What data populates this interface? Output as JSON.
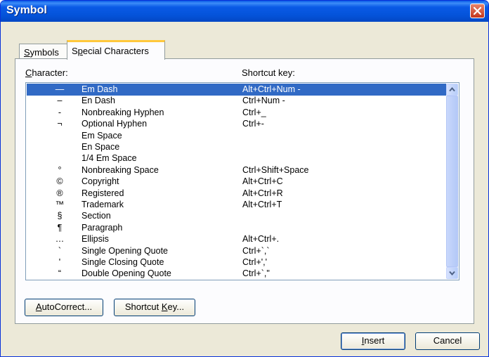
{
  "window": {
    "title": "Symbol"
  },
  "tabs": [
    {
      "label_mn": "S",
      "label_rest": "ymbols"
    },
    {
      "label_pre": "S",
      "label_mn": "p",
      "label_rest": "ecial Characters"
    }
  ],
  "columns": {
    "character_mn": "C",
    "character_rest": "haracter:",
    "shortcut": "Shortcut key:"
  },
  "rows": [
    {
      "char": "—",
      "name": "Em Dash",
      "key": "Alt+Ctrl+Num -"
    },
    {
      "char": "–",
      "name": "En Dash",
      "key": "Ctrl+Num -"
    },
    {
      "char": "-",
      "name": "Nonbreaking Hyphen",
      "key": "Ctrl+_"
    },
    {
      "char": "¬",
      "name": "Optional Hyphen",
      "key": "Ctrl+-"
    },
    {
      "char": "",
      "name": "Em Space",
      "key": ""
    },
    {
      "char": "",
      "name": "En Space",
      "key": ""
    },
    {
      "char": "",
      "name": "1/4 Em Space",
      "key": ""
    },
    {
      "char": "°",
      "name": "Nonbreaking Space",
      "key": "Ctrl+Shift+Space"
    },
    {
      "char": "©",
      "name": "Copyright",
      "key": "Alt+Ctrl+C"
    },
    {
      "char": "®",
      "name": "Registered",
      "key": "Alt+Ctrl+R"
    },
    {
      "char": "™",
      "name": "Trademark",
      "key": "Alt+Ctrl+T"
    },
    {
      "char": "§",
      "name": "Section",
      "key": ""
    },
    {
      "char": "¶",
      "name": "Paragraph",
      "key": ""
    },
    {
      "char": "…",
      "name": "Ellipsis",
      "key": "Alt+Ctrl+."
    },
    {
      "char": "`",
      "name": "Single Opening Quote",
      "key": "Ctrl+`,`"
    },
    {
      "char": "'",
      "name": "Single Closing Quote",
      "key": "Ctrl+','"
    },
    {
      "char": "“",
      "name": "Double Opening Quote",
      "key": "Ctrl+`,\""
    }
  ],
  "buttons": {
    "autocorrect_mn": "A",
    "autocorrect_rest": "utoCorrect...",
    "shortcut_pre": "Shortcut ",
    "shortcut_mn": "K",
    "shortcut_rest": "ey...",
    "insert_mn": "I",
    "insert_rest": "nsert",
    "cancel": "Cancel"
  },
  "colors": {
    "selection": "#316ac5",
    "titlebar": "#0a5ae6",
    "close": "#c4361c"
  }
}
